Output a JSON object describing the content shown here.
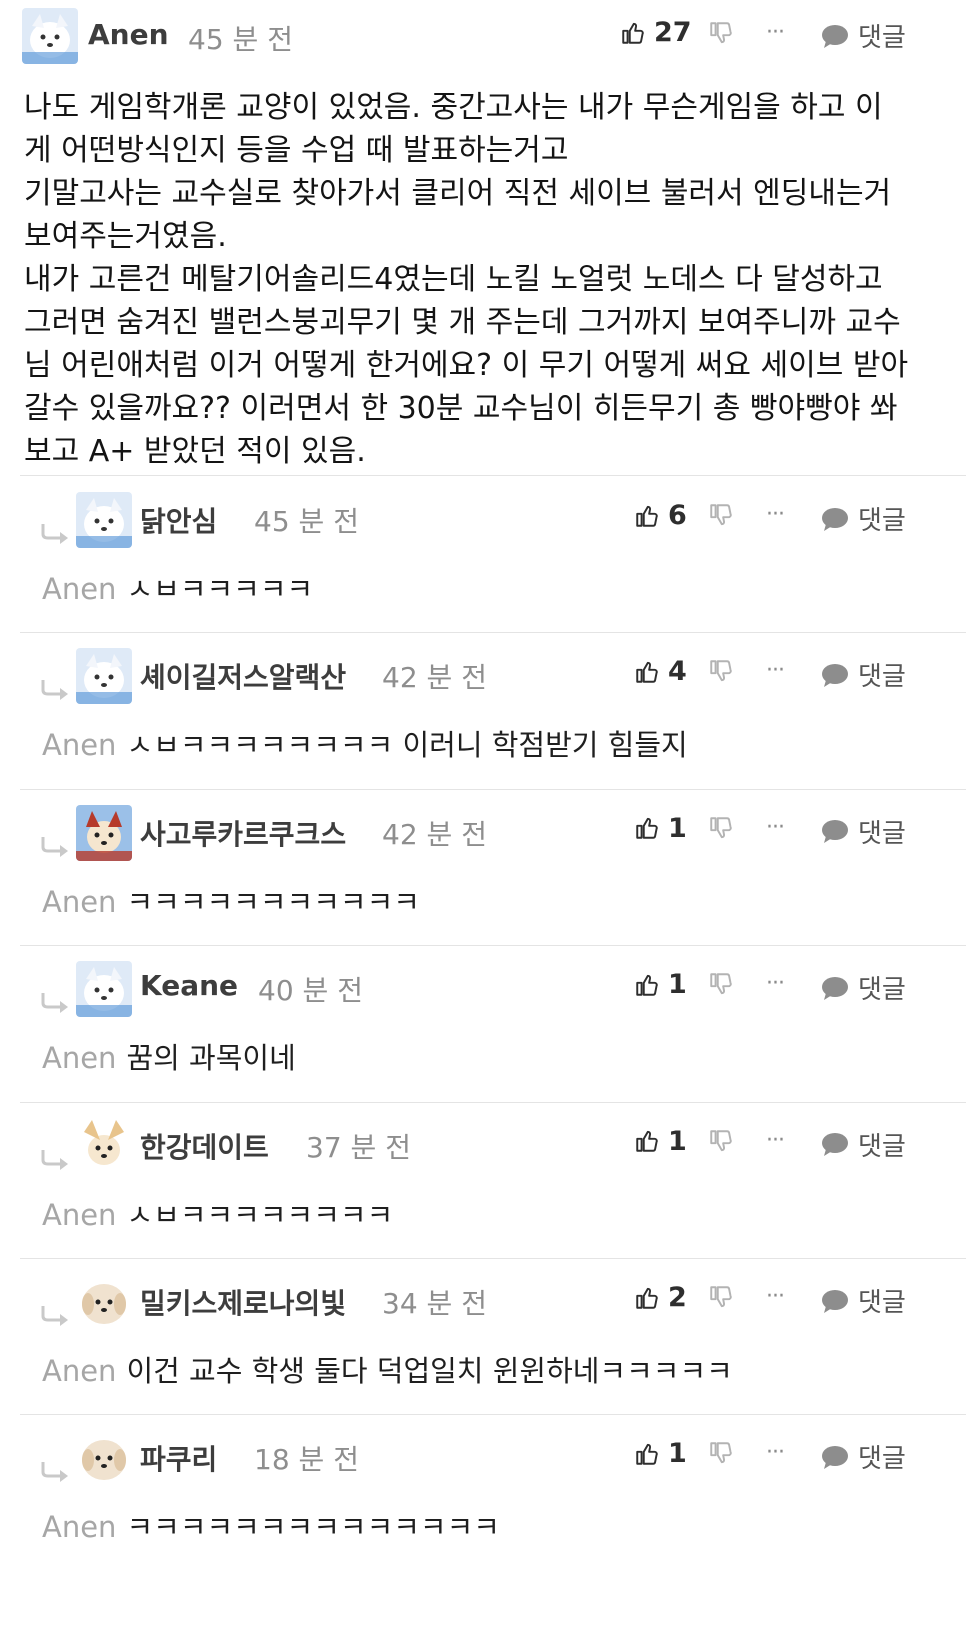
{
  "main_comment": {
    "author": "Anen",
    "time": "45 분 전",
    "likes": "27",
    "reply_label": "댓글",
    "more_label": "···",
    "text": "나도 게임학개론 교양이 있었음. 중간고사는 내가 무슨게임을 하고 이\n게 어떤방식인지 등을 수업 때 발표하는거고\n기말고사는 교수실로 찾아가서 클리어 직전 세이브 불러서 엔딩내는거\n보여주는거였음.\n내가 고른건 메탈기어솔리드4였는데 노킬 노얼럿 노데스 다 달성하고\n그러면 숨겨진 밸런스붕괴무기 몇 개 주는데 그거까지 보여주니까 교수\n님 어린애처럼 이거 어떻게 한거에요? 이 무기 어떻게 써요 세이브 받아\n갈수 있을까요?? 이러면서 한 30분 교수님이 히든무기 총 빵야빵야 쏴\n보고 A+ 받았던 적이 있음."
  },
  "replies": [
    {
      "author": "닭안심",
      "time": "45 분 전",
      "likes": "6",
      "mention": "Anen",
      "text": "ㅅㅂㅋㅋㅋㅋㅋ",
      "reply_label": "댓글",
      "more_label": "···",
      "avatar": "white-dog-avatar"
    },
    {
      "author": "셰이길저스알랙산",
      "time": "42 분 전",
      "likes": "4",
      "mention": "Anen",
      "text": "ㅅㅂㅋㅋㅋㅋㅋㅋㅋㅋ 이러니 학점받기 힘들지",
      "reply_label": "댓글",
      "more_label": "···",
      "avatar": "white-dog-avatar"
    },
    {
      "author": "사고루카르쿠크스",
      "time": "42 분 전",
      "likes": "1",
      "mention": "Anen",
      "text": "ㅋㅋㅋㅋㅋㅋㅋㅋㅋㅋㅋ",
      "reply_label": "댓글",
      "more_label": "···",
      "avatar": "fox-dog-avatar"
    },
    {
      "author": "Keane",
      "time": "40 분 전",
      "likes": "1",
      "mention": "Anen",
      "text": "꿈의 과목이네",
      "reply_label": "댓글",
      "more_label": "···",
      "avatar": "white-dog-avatar"
    },
    {
      "author": "한강데이트",
      "time": "37 분 전",
      "likes": "1",
      "mention": "Anen",
      "text": "ㅅㅂㅋㅋㅋㅋㅋㅋㅋㅋ",
      "reply_label": "댓글",
      "more_label": "···",
      "avatar": "corgi-avatar"
    },
    {
      "author": "밀키스제로나의빛",
      "time": "34 분 전",
      "likes": "2",
      "mention": "Anen",
      "text": "이건 교수 학생 둘다 덕업일치 윈윈하네ㅋㅋㅋㅋㅋ",
      "reply_label": "댓글",
      "more_label": "···",
      "avatar": "puppy-avatar"
    },
    {
      "author": "파쿠리",
      "time": "18 분 전",
      "likes": "1",
      "mention": "Anen",
      "text": "ㅋㅋㅋㅋㅋㅋㅋㅋㅋㅋㅋㅋㅋㅋ",
      "reply_label": "댓글",
      "more_label": "···",
      "avatar": "puppy-avatar"
    }
  ]
}
